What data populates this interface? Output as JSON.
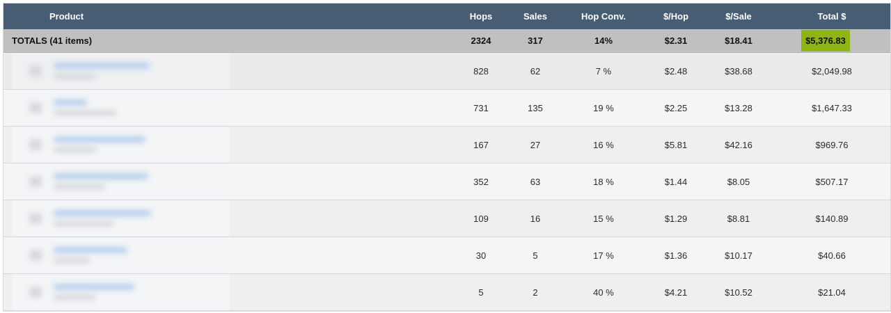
{
  "header": {
    "product": "Product",
    "hops": "Hops",
    "sales": "Sales",
    "hop_conv": "Hop Conv.",
    "per_hop": "$/Hop",
    "per_sale": "$/Sale",
    "total": "Total $"
  },
  "totals": {
    "label": "TOTALS (41 items)",
    "hops": "2324",
    "sales": "317",
    "hop_conv": "14%",
    "per_hop": "$2.31",
    "per_sale": "$18.41",
    "total": "$5,376.83"
  },
  "rows": [
    {
      "hops": "828",
      "sales": "62",
      "hop_conv": "7 %",
      "per_hop": "$2.48",
      "per_sale": "$38.68",
      "total": "$2,049.98"
    },
    {
      "hops": "731",
      "sales": "135",
      "hop_conv": "19 %",
      "per_hop": "$2.25",
      "per_sale": "$13.28",
      "total": "$1,647.33"
    },
    {
      "hops": "167",
      "sales": "27",
      "hop_conv": "16 %",
      "per_hop": "$5.81",
      "per_sale": "$42.16",
      "total": "$969.76"
    },
    {
      "hops": "352",
      "sales": "63",
      "hop_conv": "18 %",
      "per_hop": "$1.44",
      "per_sale": "$8.05",
      "total": "$507.17"
    },
    {
      "hops": "109",
      "sales": "16",
      "hop_conv": "15 %",
      "per_hop": "$1.29",
      "per_sale": "$8.81",
      "total": "$140.89"
    },
    {
      "hops": "30",
      "sales": "5",
      "hop_conv": "17 %",
      "per_hop": "$1.36",
      "per_sale": "$10.17",
      "total": "$40.66"
    },
    {
      "hops": "5",
      "sales": "2",
      "hop_conv": "40 %",
      "per_hop": "$4.21",
      "per_sale": "$10.52",
      "total": "$21.04"
    }
  ],
  "colors": {
    "header_bg": "#465d74",
    "totals_bg": "#c0c0c0",
    "total_highlight": "#8fb415"
  }
}
